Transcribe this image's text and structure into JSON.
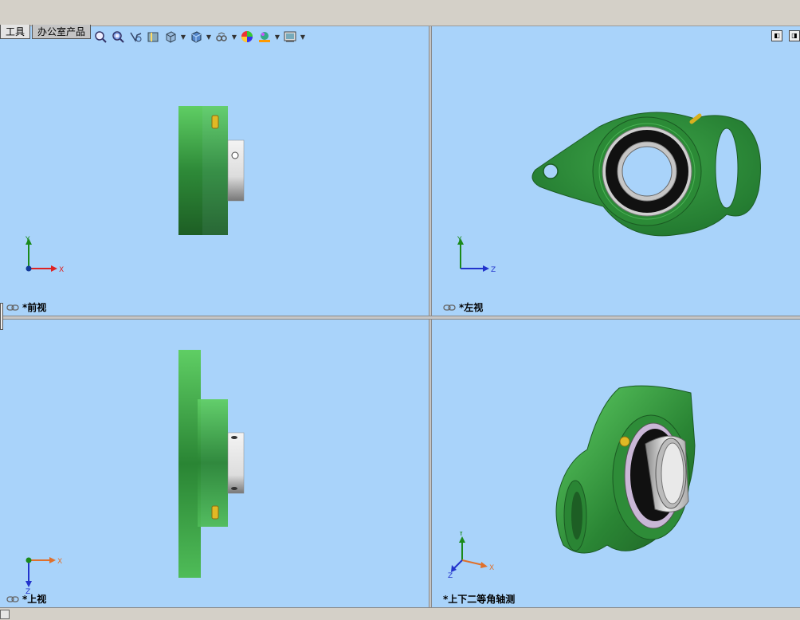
{
  "tabs": [
    {
      "label": "工具",
      "active": false
    },
    {
      "label": "办公室产品",
      "active": true
    }
  ],
  "toolbar": {
    "icons": [
      "zoom-to-fit-icon",
      "zoom-area-icon",
      "previous-view-icon",
      "section-view-icon",
      "view-orientation-icon",
      "display-style-icon",
      "hide-show-items-icon",
      "edit-appearance-icon",
      "apply-scene-icon",
      "view-settings-icon"
    ]
  },
  "viewports": {
    "front": {
      "label": "*前视",
      "triad": {
        "h": "X",
        "v": "Y"
      }
    },
    "left": {
      "label": "*左视",
      "triad": {
        "h": "Z",
        "v": "Y"
      }
    },
    "top": {
      "label": "*上视",
      "triad": {
        "h": "X",
        "v": "Z"
      }
    },
    "iso": {
      "label": "*上下二等角轴测",
      "triad": {
        "x": "X",
        "y": "Y",
        "z": "Z"
      }
    }
  },
  "colors": {
    "viewport_bg": "#a9d3fa",
    "part_green": "#3a9a45",
    "part_dark_green": "#1f6b2c",
    "bearing_black": "#111111",
    "steel": "#c8c8c8",
    "grease_fitting": "#d8b020"
  }
}
